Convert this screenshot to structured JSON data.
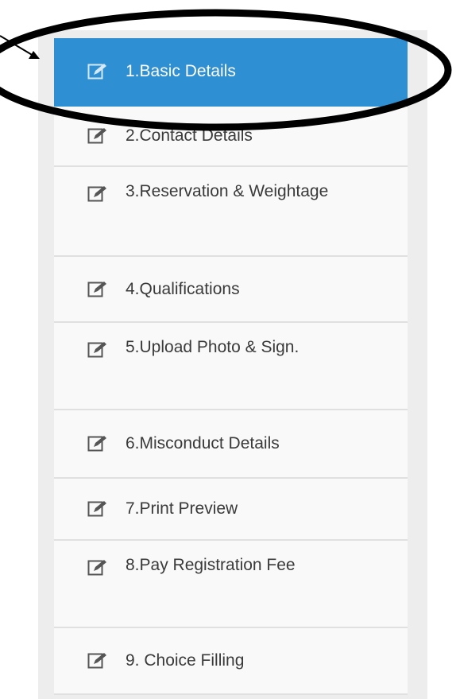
{
  "menu": {
    "items": [
      {
        "label": "1.Basic Details",
        "active": true
      },
      {
        "label": "2.Contact Details"
      },
      {
        "label": "3.Reservation & Weightage"
      },
      {
        "label": "4.Qualifications"
      },
      {
        "label": "5.Upload Photo & Sign."
      },
      {
        "label": "6.Misconduct Details"
      },
      {
        "label": "7.Print Preview"
      },
      {
        "label": "8.Pay Registration Fee"
      },
      {
        "label": "9. Choice Filling"
      }
    ]
  },
  "icons": {
    "item_icon": "edit-icon",
    "annotation": "arrow-icon"
  },
  "colors": {
    "active_bg": "#2e8fd2",
    "item_bg": "#f9f9f9",
    "panel_bg": "#ededed",
    "text": "#3a3a3a",
    "annotation": "#000000"
  }
}
